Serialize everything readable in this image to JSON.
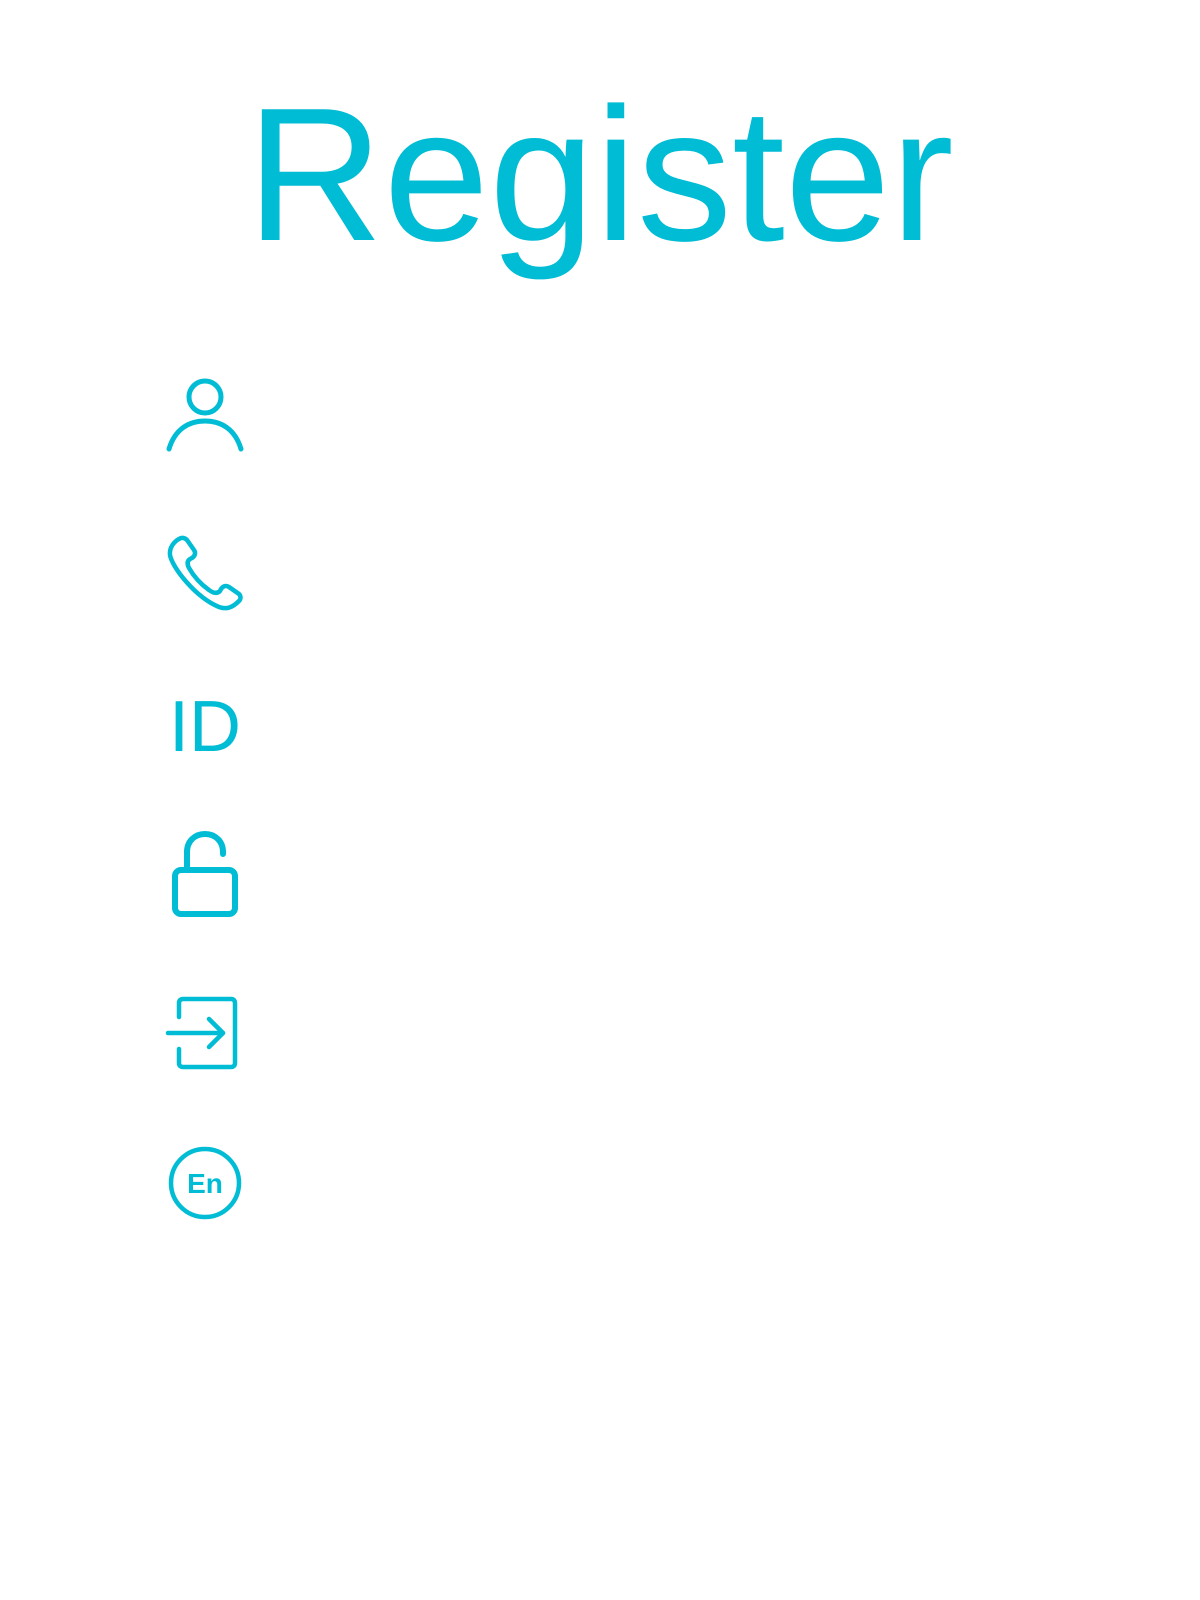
{
  "header": {
    "title": "Register"
  },
  "theme": {
    "accent": "#00BCD4",
    "background": "#FFFFFF"
  },
  "fields": [
    {
      "icon": "user-icon",
      "value": ""
    },
    {
      "icon": "phone-icon",
      "value": ""
    },
    {
      "icon": "id-icon",
      "label": "ID",
      "value": ""
    },
    {
      "icon": "unlock-icon",
      "value": ""
    },
    {
      "icon": "login-icon",
      "value": ""
    },
    {
      "icon": "language-icon",
      "label": "En",
      "value": ""
    }
  ]
}
